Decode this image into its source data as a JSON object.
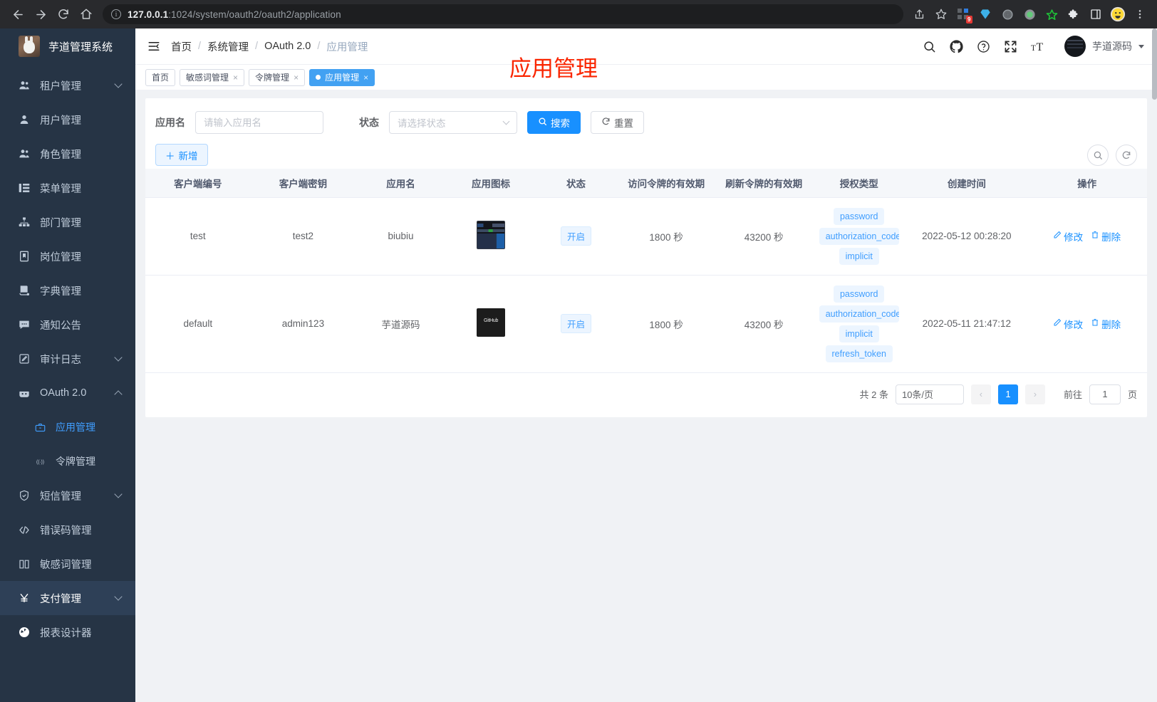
{
  "browser": {
    "url_host": "127.0.0.1",
    "url_rest": ":1024/system/oauth2/oauth2/application",
    "back_icon": "back-arrow-icon",
    "forward_icon": "forward-arrow-icon",
    "reload_icon": "reload-icon",
    "home_icon": "home-icon",
    "share_icon": "share-icon",
    "bookmark_icon": "star-icon",
    "extension_badge": "9",
    "menu_icon": "kebab-menu-icon"
  },
  "sidebar": {
    "logo_text": "芋道管理系统",
    "items": [
      {
        "label": "租户管理",
        "icon": "users-icon",
        "expandable": true
      },
      {
        "label": "用户管理",
        "icon": "user-icon",
        "expandable": false
      },
      {
        "label": "角色管理",
        "icon": "users-icon",
        "expandable": false
      },
      {
        "label": "菜单管理",
        "icon": "list-icon",
        "expandable": false
      },
      {
        "label": "部门管理",
        "icon": "sitemap-icon",
        "expandable": false
      },
      {
        "label": "岗位管理",
        "icon": "badge-icon",
        "expandable": false
      },
      {
        "label": "字典管理",
        "icon": "book-icon",
        "expandable": false
      },
      {
        "label": "通知公告",
        "icon": "chat-icon",
        "expandable": false
      },
      {
        "label": "审计日志",
        "icon": "edit-doc-icon",
        "expandable": true
      },
      {
        "label": "OAuth 2.0",
        "icon": "robot-icon",
        "expandable": true,
        "expanded": true
      },
      {
        "label": "应用管理",
        "icon": "briefcase-icon",
        "sub": true,
        "active": true
      },
      {
        "label": "令牌管理",
        "icon": "token-icon",
        "sub": true,
        "active": false
      },
      {
        "label": "短信管理",
        "icon": "shield-icon",
        "expandable": true
      },
      {
        "label": "错误码管理",
        "icon": "code-icon",
        "expandable": false
      },
      {
        "label": "敏感词管理",
        "icon": "book-open-icon",
        "expandable": false
      },
      {
        "label": "支付管理",
        "icon": "yuan-icon",
        "expandable": true,
        "highlight": true
      },
      {
        "label": "报表设计器",
        "icon": "gear-circle-icon",
        "expandable": false
      }
    ]
  },
  "topbar": {
    "hamburger_icon": "hamburger-menu-icon",
    "breadcrumbs": [
      "首页",
      "系统管理",
      "OAuth 2.0",
      "应用管理"
    ],
    "icons": [
      "search-icon",
      "github-icon",
      "help-circle-icon",
      "fullscreen-icon",
      "font-size-icon"
    ],
    "username": "芋道源码"
  },
  "tabs": {
    "items": [
      {
        "label": "首页",
        "closable": false,
        "active": false
      },
      {
        "label": "敏感词管理",
        "closable": true,
        "active": false
      },
      {
        "label": "令牌管理",
        "closable": true,
        "active": false
      },
      {
        "label": "应用管理",
        "closable": true,
        "active": true
      }
    ],
    "close_glyph": "×",
    "watermark": "应用管理",
    "watermark_color": "#fa2500"
  },
  "filter": {
    "app_name_label": "应用名",
    "app_name_placeholder": "请输入应用名",
    "app_name_value": "",
    "status_label": "状态",
    "status_placeholder": "请选择状态",
    "search_button": "搜索",
    "search_icon": "search-icon",
    "reset_button": "重置",
    "reset_icon": "refresh-icon"
  },
  "toolbar": {
    "add_button": "新增",
    "add_icon": "plus-icon",
    "search_round_icon": "search-icon",
    "refresh_round_icon": "refresh-icon"
  },
  "table": {
    "columns": [
      "客户端编号",
      "客户端密钥",
      "应用名",
      "应用图标",
      "状态",
      "访问令牌的有效期",
      "刷新令牌的有效期",
      "授权类型",
      "创建时间",
      "操作"
    ],
    "rows": [
      {
        "client_id": "test",
        "client_secret": "test2",
        "app_name": "biubiu",
        "icon": "dark-dashboard-thumbnail",
        "status": "开启",
        "access_token_validity": "1800 秒",
        "refresh_token_validity": "43200 秒",
        "grant_types": [
          "password",
          "authorization_code",
          "implicit"
        ],
        "create_time": "2022-05-12 00:28:20",
        "edit_label": "修改",
        "delete_label": "删除"
      },
      {
        "client_id": "default",
        "client_secret": "admin123",
        "app_name": "芋道源码",
        "icon": "github-logo-thumbnail",
        "status": "开启",
        "access_token_validity": "1800 秒",
        "refresh_token_validity": "43200 秒",
        "grant_types": [
          "password",
          "authorization_code",
          "implicit",
          "refresh_token"
        ],
        "create_time": "2022-05-11 21:47:12",
        "edit_label": "修改",
        "delete_label": "删除"
      }
    ]
  },
  "pagination": {
    "total_text": "共 2 条",
    "page_size": "10条/页",
    "prev_glyph": "‹",
    "next_glyph": "›",
    "current_page": "1",
    "jump_prefix": "前往",
    "jump_value": "1",
    "jump_suffix": "页"
  },
  "colors": {
    "accent": "#1890ff",
    "sidebar_bg": "#263445",
    "tag_bg": "#ecf5ff",
    "tag_text": "#409eff"
  }
}
